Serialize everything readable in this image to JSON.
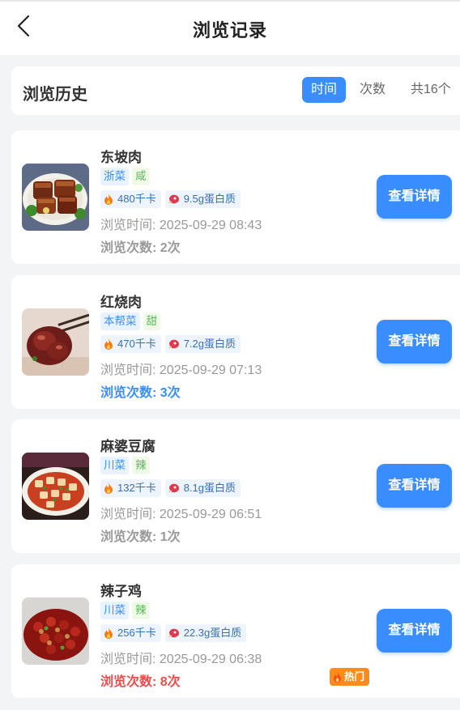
{
  "header": {
    "title": "浏览记录"
  },
  "history_header": {
    "title": "浏览历史",
    "sort_tabs": [
      {
        "label": "时间",
        "active": true
      },
      {
        "label": "次数",
        "active": false
      }
    ],
    "total": "共16个"
  },
  "items": [
    {
      "name": "东坡肉",
      "cuisine": "浙菜",
      "taste": "咸",
      "calories": "480千卡",
      "protein": "9.5g蛋白质",
      "time": "浏览时间: 2025-09-29 08:43",
      "count": "浏览次数: 2次",
      "detail": "查看详情"
    },
    {
      "name": "红烧肉",
      "cuisine": "本帮菜",
      "taste": "甜",
      "calories": "470千卡",
      "protein": "7.2g蛋白质",
      "time": "浏览时间: 2025-09-29 07:13",
      "count": "浏览次数: 3次",
      "detail": "查看详情"
    },
    {
      "name": "麻婆豆腐",
      "cuisine": "川菜",
      "taste": "辣",
      "calories": "132千卡",
      "protein": "8.1g蛋白质",
      "time": "浏览时间: 2025-09-29 06:51",
      "count": "浏览次数: 1次",
      "detail": "查看详情"
    },
    {
      "name": "辣子鸡",
      "cuisine": "川菜",
      "taste": "辣",
      "calories": "256千卡",
      "protein": "22.3g蛋白质",
      "time": "浏览时间: 2025-09-29 06:38",
      "count": "浏览次数: 8次",
      "detail": "查看详情",
      "badge": "热门"
    }
  ],
  "colors": {
    "accent": "#3a8dff",
    "hot": "#ff8c1a",
    "count_red": "#f04b4b",
    "background": "#f3f4f6"
  },
  "icons": {
    "back": "chevron-left-icon",
    "calories": "flame-icon",
    "protein": "meat-icon",
    "badge": "flame-icon"
  }
}
